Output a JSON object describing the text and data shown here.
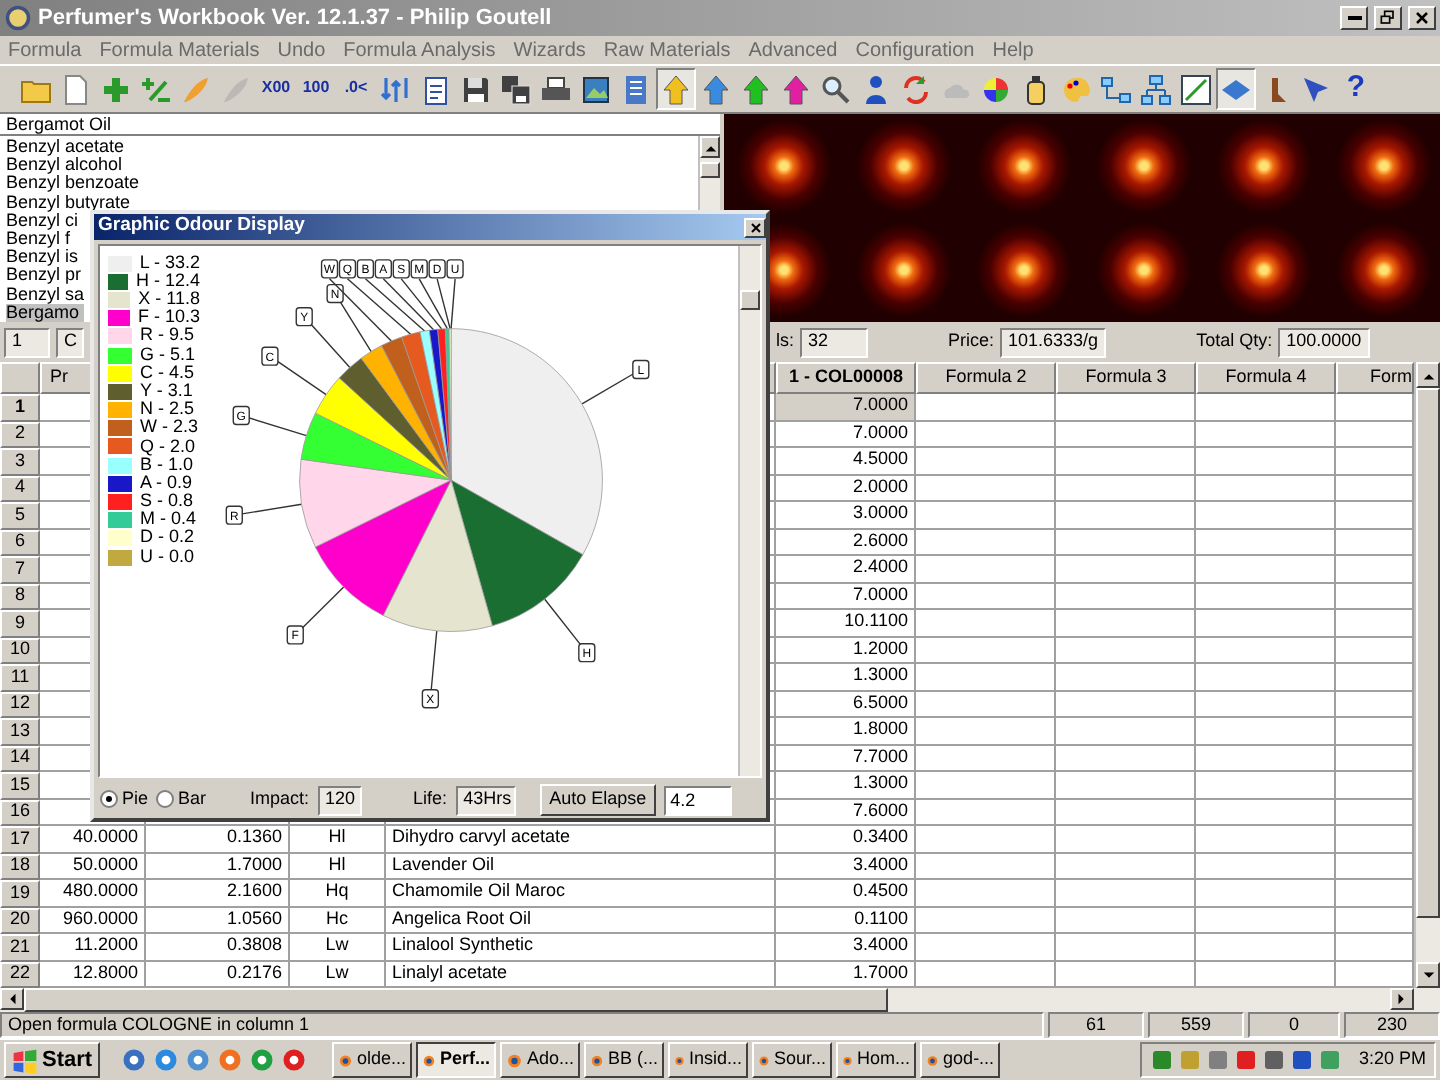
{
  "window": {
    "title": "Perfumer's Workbook Ver. 12.1.37 - Philip Goutell"
  },
  "menu": [
    "Formula",
    "Formula Materials",
    "Undo",
    "Formula Analysis",
    "Wizards",
    "Raw Materials",
    "Advanced",
    "Configuration",
    "Help"
  ],
  "toolbar": [
    {
      "kind": "icon",
      "pressed": false,
      "disabled": false
    },
    {
      "kind": "icon",
      "pressed": false,
      "disabled": false
    },
    {
      "kind": "icon",
      "pressed": false,
      "disabled": false
    },
    {
      "kind": "icon",
      "pressed": false,
      "disabled": false
    },
    {
      "kind": "icon",
      "pressed": false,
      "disabled": false
    },
    {
      "kind": "icon",
      "pressed": false,
      "disabled": true
    },
    {
      "kind": "text",
      "label": "X00",
      "pressed": false,
      "disabled": false
    },
    {
      "kind": "text",
      "label": "100",
      "pressed": false,
      "disabled": false
    },
    {
      "kind": "text",
      "label": ".0<",
      "pressed": false,
      "disabled": false
    },
    {
      "kind": "icon",
      "pressed": false,
      "disabled": false
    },
    {
      "kind": "icon",
      "pressed": false,
      "disabled": false
    },
    {
      "kind": "icon",
      "pressed": false,
      "disabled": false
    },
    {
      "kind": "icon",
      "pressed": false,
      "disabled": false
    },
    {
      "kind": "icon",
      "pressed": false,
      "disabled": false
    },
    {
      "kind": "icon",
      "pressed": false,
      "disabled": false
    },
    {
      "kind": "icon",
      "pressed": false,
      "disabled": false
    },
    {
      "kind": "icon",
      "pressed": true,
      "disabled": false
    },
    {
      "kind": "icon",
      "pressed": false,
      "disabled": false
    },
    {
      "kind": "icon",
      "pressed": false,
      "disabled": false
    },
    {
      "kind": "icon",
      "pressed": false,
      "disabled": false
    },
    {
      "kind": "icon",
      "pressed": false,
      "disabled": false
    },
    {
      "kind": "icon",
      "pressed": false,
      "disabled": false
    },
    {
      "kind": "icon",
      "pressed": false,
      "disabled": false
    },
    {
      "kind": "icon",
      "pressed": false,
      "disabled": false
    },
    {
      "kind": "icon",
      "pressed": false,
      "disabled": false
    },
    {
      "kind": "icon",
      "pressed": false,
      "disabled": false
    },
    {
      "kind": "icon",
      "pressed": false,
      "disabled": false
    },
    {
      "kind": "icon",
      "pressed": false,
      "disabled": false
    },
    {
      "kind": "icon",
      "pressed": false,
      "disabled": false
    },
    {
      "kind": "icon",
      "pressed": false,
      "disabled": false
    },
    {
      "kind": "icon",
      "pressed": true,
      "disabled": false
    },
    {
      "kind": "icon",
      "pressed": false,
      "disabled": false
    },
    {
      "kind": "icon",
      "pressed": false,
      "disabled": false
    },
    {
      "kind": "text",
      "label": "?",
      "pressed": false,
      "disabled": false
    }
  ],
  "material_search": {
    "value": "Bergamot Oil"
  },
  "materials": [
    {
      "label": "Benzyl acetate",
      "selected": false
    },
    {
      "label": "Benzyl alcohol",
      "selected": false
    },
    {
      "label": "Benzyl benzoate",
      "selected": false
    },
    {
      "label": "Benzyl butyrate",
      "selected": false
    },
    {
      "label": "Benzyl ci",
      "selected": false
    },
    {
      "label": "Benzyl f",
      "selected": false
    },
    {
      "label": "Benzyl is",
      "selected": false
    },
    {
      "label": "Benzyl pr",
      "selected": false
    },
    {
      "label": "Benzyl sa",
      "selected": false
    },
    {
      "label": "Bergamo",
      "selected": true
    }
  ],
  "formula_fields": {
    "row": "1",
    "column": "C"
  },
  "summary": [
    {
      "label": "ls:",
      "value": "32"
    },
    {
      "label": "Price:",
      "value": "101.6333/g"
    },
    {
      "label": "Total Qty:",
      "value": "100.0000"
    }
  ],
  "table": {
    "columns": [
      {
        "label": "Pr",
        "selected": false
      },
      {
        "label": "1 - COL00008",
        "selected": true
      },
      {
        "label": "Formula 2",
        "selected": false
      },
      {
        "label": "Formula 3",
        "selected": false
      },
      {
        "label": "Formula 4",
        "selected": false
      },
      {
        "label": "Form",
        "selected": false
      }
    ],
    "rows": [
      {
        "number": "1",
        "formulas": [
          "7.0000"
        ],
        "selected": true
      },
      {
        "number": "2",
        "formulas": [
          "7.0000"
        ],
        "selected": false
      },
      {
        "number": "3",
        "formulas": [
          "4.5000"
        ],
        "selected": false
      },
      {
        "number": "4",
        "formulas": [
          "2.0000"
        ],
        "selected": false
      },
      {
        "number": "5",
        "formulas": [
          "3.0000"
        ],
        "selected": false
      },
      {
        "number": "6",
        "formulas": [
          "2.6000"
        ],
        "selected": false
      },
      {
        "number": "7",
        "formulas": [
          "2.4000"
        ],
        "selected": false
      },
      {
        "number": "8",
        "formulas": [
          "7.0000"
        ],
        "selected": false
      },
      {
        "number": "9",
        "formulas": [
          "10.1100"
        ],
        "selected": false
      },
      {
        "number": "10",
        "formulas": [
          "1.2000"
        ],
        "selected": false
      },
      {
        "number": "11",
        "formulas": [
          "1.3000"
        ],
        "selected": false
      },
      {
        "number": "12",
        "formulas": [
          "6.5000"
        ],
        "selected": false
      },
      {
        "number": "13",
        "formulas": [
          "1.8000"
        ],
        "selected": false
      },
      {
        "number": "14",
        "formulas": [
          "7.7000"
        ],
        "selected": false
      },
      {
        "number": "15",
        "formulas": [
          "1.3000"
        ],
        "selected": false
      },
      {
        "number": "16",
        "formulas": [
          "7.6000"
        ],
        "selected": false
      },
      {
        "number": "17",
        "cells": [
          "40.0000",
          "0.1360",
          "Hl",
          "Dihydro carvyl acetate"
        ],
        "formulas": [
          "0.3400"
        ],
        "selected": false
      },
      {
        "number": "18",
        "cells": [
          "50.0000",
          "1.7000",
          "Hl",
          "Lavender Oil"
        ],
        "formulas": [
          "3.4000"
        ],
        "selected": false
      },
      {
        "number": "19",
        "cells": [
          "480.0000",
          "2.1600",
          "Hq",
          "Chamomile Oil Maroc"
        ],
        "formulas": [
          "0.4500"
        ],
        "selected": false
      },
      {
        "number": "20",
        "cells": [
          "960.0000",
          "1.0560",
          "Hc",
          "Angelica Root Oil"
        ],
        "formulas": [
          "0.1100"
        ],
        "selected": false
      },
      {
        "number": "21",
        "cells": [
          "11.2000",
          "0.3808",
          "Lw",
          "Linalool Synthetic"
        ],
        "formulas": [
          "3.4000"
        ],
        "selected": false
      },
      {
        "number": "22",
        "cells": [
          "12.8000",
          "0.2176",
          "Lw",
          "Linalyl acetate"
        ],
        "formulas": [
          "1.7000"
        ],
        "selected": false
      }
    ]
  },
  "odour_display": {
    "title": "Graphic Odour Display",
    "legend": [
      {
        "label": "L - 33.2",
        "color": "#efefef"
      },
      {
        "label": "H - 12.4",
        "color": "#1b6e32"
      },
      {
        "label": "X - 11.8",
        "color": "#e5e5cf"
      },
      {
        "label": "F - 10.3",
        "color": "#ff00cc"
      },
      {
        "label": "R - 9.5",
        "color": "#ffd6ea"
      },
      {
        "label": "G - 5.1",
        "color": "#33ff33"
      },
      {
        "label": "C - 4.5",
        "color": "#ffff00"
      },
      {
        "label": "Y - 3.1",
        "color": "#5e5e2e"
      },
      {
        "label": "N - 2.5",
        "color": "#ffb300"
      },
      {
        "label": "W - 2.3",
        "color": "#c0601c"
      },
      {
        "label": "Q - 2.0",
        "color": "#e65a20"
      },
      {
        "label": "B - 1.0",
        "color": "#99ffff"
      },
      {
        "label": "A - 0.9",
        "color": "#1818c8"
      },
      {
        "label": "S - 0.8",
        "color": "#ff2020"
      },
      {
        "label": "M - 0.4",
        "color": "#33cc99"
      },
      {
        "label": "D - 0.2",
        "color": "#ffffcc"
      },
      {
        "label": "U - 0.0",
        "color": "#c0aa40"
      }
    ],
    "chart_data": {
      "type": "pie",
      "categories": [
        "L",
        "H",
        "X",
        "F",
        "R",
        "G",
        "C",
        "Y",
        "N",
        "W",
        "Q",
        "B",
        "A",
        "S",
        "M",
        "D",
        "U"
      ],
      "values": [
        33.2,
        12.4,
        11.8,
        10.3,
        9.5,
        5.1,
        4.5,
        3.1,
        2.5,
        2.3,
        2.0,
        1.0,
        0.9,
        0.8,
        0.4,
        0.2,
        0.0
      ]
    },
    "view_options": [
      {
        "label": "Pie",
        "selected": true
      },
      {
        "label": "Bar",
        "selected": false
      }
    ],
    "impact": {
      "label": "Impact:",
      "value": "120"
    },
    "life": {
      "label": "Life:",
      "value": "43Hrs"
    },
    "auto_elapse_button": "Auto Elapse",
    "elapse": {
      "value": "4.2"
    }
  },
  "status_bar": [
    "Open formula COLOGNE in column 1",
    "61",
    "559",
    "0",
    "230"
  ],
  "taskbar": {
    "start": "Start",
    "tasks": [
      {
        "label": "olde...",
        "active": false
      },
      {
        "label": "Perf...",
        "active": true
      },
      {
        "label": "Ado...",
        "active": false
      },
      {
        "label": "BB (...",
        "active": false
      },
      {
        "label": "Insid...",
        "active": false
      },
      {
        "label": "Sour...",
        "active": false
      },
      {
        "label": "Hom...",
        "active": false
      },
      {
        "label": "god-...",
        "active": false
      }
    ],
    "clock": "3:20 PM"
  }
}
